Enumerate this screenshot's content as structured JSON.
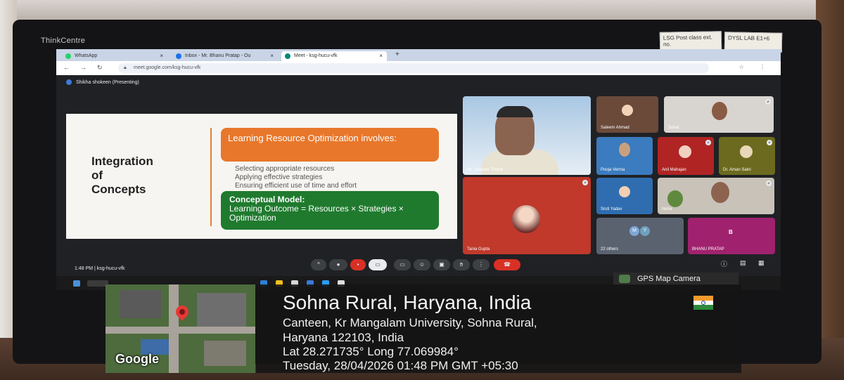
{
  "monitor": {
    "brand": "ThinkCentre",
    "sticky_note_1": "LSG Post class ext. no.",
    "sticky_note_2": "DYSL LAB E1+6"
  },
  "browser": {
    "tabs": [
      {
        "label": "WhatsApp",
        "color": "#25d366"
      },
      {
        "label": "Inbox - Mr. Bhanu Pratap - Ou",
        "color": "#1a73e8"
      },
      {
        "label": "Meet - ksg-hucu-vfk",
        "color": "#00897b"
      }
    ],
    "new_tab": "+",
    "url": "meet.google.com/ksg-hucu-vfk"
  },
  "meet": {
    "presenter": "Shikha shokeen (Presenting)",
    "time_code": "1:48 PM | ksg-hucu-vfk",
    "participants": [
      {
        "name": "Mr. Sanjeev Trivedi"
      },
      {
        "name": "Tania Gupta"
      },
      {
        "name": "Saleem Ahmad"
      },
      {
        "name": "Sonal"
      },
      {
        "name": "Pooja Verma"
      },
      {
        "name": "Anil Mahajan"
      },
      {
        "name": "Dr. Aman Saini"
      },
      {
        "name": "Sruti Yadav"
      },
      {
        "name": "Neha"
      },
      {
        "name": "22 others"
      },
      {
        "name": "BHANU PRATAP"
      }
    ],
    "others_letters": [
      "M",
      "Y"
    ],
    "bhanu_letter": "B"
  },
  "slide": {
    "title_lines": [
      "Integration",
      "of",
      "Concepts"
    ],
    "orange_box": "Learning Resource Optimization involves:",
    "bullets": [
      "Selecting appropriate resources",
      "Applying effective strategies",
      "Ensuring efficient use of time and effort"
    ],
    "green_title": "Conceptual Model:",
    "green_body": "Learning Outcome = Resources × Strategies × Optimization"
  },
  "taskbar": {
    "gps_app": "GPS Map Camera"
  },
  "gps": {
    "title": "Sohna Rural, Haryana, India",
    "address_line1": "Canteen, Kr Mangalam University, Sohna Rural,",
    "address_line2": "Haryana 122103, India",
    "coords": "Lat 28.271735° Long 77.069984°",
    "datetime": "Tuesday, 28/04/2026 01:48 PM GMT +05:30",
    "map_brand": "Google"
  }
}
